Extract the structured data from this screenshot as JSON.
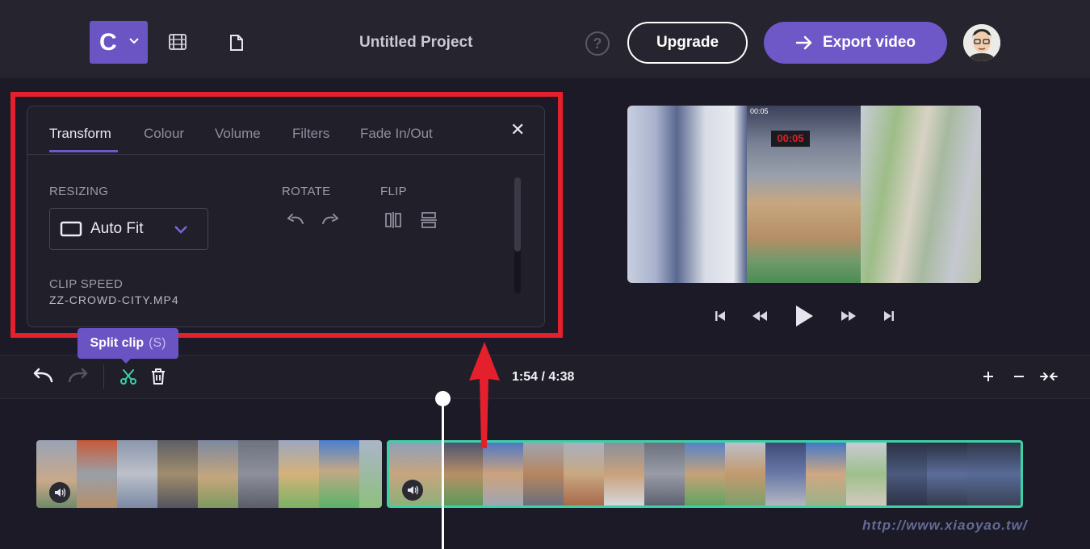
{
  "header": {
    "logo_letter": "C",
    "project_title": "Untitled Project",
    "help_symbol": "?",
    "upgrade_label": "Upgrade",
    "export_label": "Export video",
    "icons": [
      "chevron-down-icon",
      "film-icon",
      "document-icon",
      "help-icon",
      "arrow-right-icon",
      "avatar"
    ]
  },
  "panel": {
    "tabs": [
      {
        "label": "Transform",
        "active": true
      },
      {
        "label": "Colour",
        "active": false
      },
      {
        "label": "Volume",
        "active": false
      },
      {
        "label": "Filters",
        "active": false
      },
      {
        "label": "Fade In/Out",
        "active": false
      }
    ],
    "close_symbol": "✕",
    "resizing_label": "RESIZING",
    "resize_value": "Auto Fit",
    "rotate_label": "ROTATE",
    "flip_label": "FLIP",
    "clip_speed_label": "CLIP SPEED",
    "clip_name": "ZZ-CROWD-CITY.MP4",
    "highlight_color": "#e5202d"
  },
  "preview": {
    "overlay_time": "00:05",
    "overlay_timer": "00:05"
  },
  "player": {
    "controls": [
      "skip-back",
      "rewind",
      "play",
      "fast-forward",
      "skip-forward"
    ]
  },
  "timeline": {
    "tooltip_label": "Split clip",
    "tooltip_shortcut": "(S)",
    "timecode": "1:54 / 4:38",
    "accent_color": "#3ed0a6"
  },
  "watermark": "http://www.xiaoyao.tw/",
  "colors": {
    "brand_purple": "#6e57c7",
    "selected_clip_border": "#3ed0a6",
    "arrow_red": "#e5202d"
  }
}
